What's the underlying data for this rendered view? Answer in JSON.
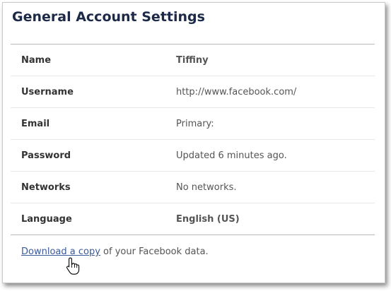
{
  "page": {
    "title": "General Account Settings"
  },
  "settings": [
    {
      "label": "Name",
      "value": "Tiffiny"
    },
    {
      "label": "Username",
      "value": "http://www.facebook.com/"
    },
    {
      "label": "Email",
      "value": "Primary:"
    },
    {
      "label": "Password",
      "value": "Updated 6 minutes ago."
    },
    {
      "label": "Networks",
      "value": "No networks."
    },
    {
      "label": "Language",
      "value": "English (US)"
    }
  ],
  "footer": {
    "link_text": "Download a copy",
    "trailing_text": " of your Facebook data."
  },
  "icons": {
    "cursor": "hand-pointer-icon"
  },
  "colors": {
    "title": "#1c2a47",
    "link": "#3b5998",
    "label": "#333333",
    "value": "#555555"
  }
}
